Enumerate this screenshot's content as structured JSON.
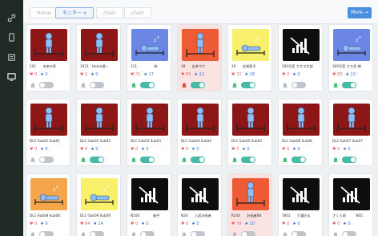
{
  "sidebar": {
    "items": [
      {
        "icon": "link-icon"
      },
      {
        "icon": "phone-icon"
      },
      {
        "icon": "document-icon"
      },
      {
        "icon": "monitor-icon"
      }
    ]
  },
  "topbar": {
    "tabs": [
      {
        "label": "Home",
        "active": false
      },
      {
        "label": "モニター ∨",
        "active": true
      },
      {
        "label": "chart",
        "active": false
      },
      {
        "label": "chart",
        "active": false
      }
    ],
    "more_label": "More →"
  },
  "cards": [
    {
      "label": "101　　未来の家",
      "heart": "0",
      "lung": "0",
      "icon": "person-standing",
      "bg": "#8c1716",
      "fg": "#8fbdf4",
      "toggle": false,
      "alert": false,
      "bell": "gray"
    },
    {
      "label": "1021　Home通ー",
      "heart": "0",
      "lung": "0",
      "icon": "person-standing",
      "bg": "#8c1716",
      "fg": "#8fbdf4",
      "toggle": false,
      "alert": false,
      "bell": "gray"
    },
    {
      "label": "111　　　　　😂",
      "heart": "71",
      "lung": "17",
      "icon": "person-sleeping",
      "bg": "#6c86e6",
      "fg": "#8fbdf4",
      "toggle": true,
      "alert": false,
      "bell": "green"
    },
    {
      "label": "18　　白井タケ",
      "heart": "65",
      "lung": "22",
      "icon": "person-standing",
      "bg": "#ef5b35",
      "fg": "#8fbdf4",
      "toggle": true,
      "alert": true,
      "bell": "red"
    },
    {
      "label": "19　　金城智子",
      "heart": "72",
      "lung": "18",
      "icon": "person-sleeping",
      "bg": "#f8f06a",
      "fg": "#8fbdf4",
      "toggle": true,
      "alert": false,
      "bell": "green"
    },
    {
      "label": "200号室 カオス大部",
      "heart": "0",
      "lung": "0",
      "icon": "no-signal",
      "bg": "#0e0e0e",
      "fg": "#ffffff",
      "toggle": false,
      "alert": false,
      "bell": "gray"
    },
    {
      "label": "300号室 オス武 様",
      "heart": "83",
      "lung": "13",
      "icon": "person-sleeping",
      "bg": "#6c86e6",
      "fg": "#8fbdf4",
      "toggle": true,
      "alert": false,
      "bell": "green"
    },
    {
      "label": "DLC-Sub01 Sub01",
      "heart": "0",
      "lung": "0",
      "icon": "person-standing",
      "bg": "#8c1716",
      "fg": "#8fbdf4",
      "toggle": false,
      "alert": false,
      "bell": "gray"
    },
    {
      "label": "DLC-Sub02 Sub02",
      "heart": "0",
      "lung": "0",
      "icon": "person-standing",
      "bg": "#8c1716",
      "fg": "#8fbdf4",
      "toggle": true,
      "alert": false,
      "bell": "green"
    },
    {
      "label": "DLC-Sub03 Sub03",
      "heart": "0",
      "lung": "0",
      "icon": "person-standing",
      "bg": "#8c1716",
      "fg": "#8fbdf4",
      "toggle": true,
      "alert": false,
      "bell": "green"
    },
    {
      "label": "DLC-Sub04 Sub04",
      "heart": "0",
      "lung": "0",
      "icon": "person-standing",
      "bg": "#8c1716",
      "fg": "#8fbdf4",
      "toggle": true,
      "alert": false,
      "bell": "green"
    },
    {
      "label": "DLC-Sub05 Sub05",
      "heart": "0",
      "lung": "0",
      "icon": "person-standing",
      "bg": "#8c1716",
      "fg": "#8fbdf4",
      "toggle": true,
      "alert": false,
      "bell": "green"
    },
    {
      "label": "DLC-Sub06 Sub06",
      "heart": "0",
      "lung": "0",
      "icon": "person-standing",
      "bg": "#8c1716",
      "fg": "#8fbdf4",
      "toggle": true,
      "alert": false,
      "bell": "green"
    },
    {
      "label": "DLC-Sub07 Sub07",
      "heart": "0",
      "lung": "0",
      "icon": "person-standing",
      "bg": "#8c1716",
      "fg": "#8fbdf4",
      "toggle": true,
      "alert": false,
      "bell": "green"
    },
    {
      "label": "DLC-Sub08 Sub08",
      "heart": "0",
      "lung": "0",
      "icon": "person-sleeping",
      "bg": "#f5a64a",
      "fg": "#8fbdf4",
      "toggle": false,
      "alert": false,
      "bell": "gray"
    },
    {
      "label": "DLC-Sub09 Sub09",
      "heart": "64",
      "lung": "14",
      "icon": "person-sleeping",
      "bg": "#f8f06a",
      "fg": "#8fbdf4",
      "toggle": false,
      "alert": false,
      "bell": "gray"
    },
    {
      "label": "N106　　　　雄子",
      "heart": "0",
      "lung": "0",
      "icon": "no-signal",
      "bg": "#0e0e0e",
      "fg": "#ffffff",
      "toggle": false,
      "alert": false,
      "bell": "gray"
    },
    {
      "label": "N26　　入居計画者",
      "heart": "0",
      "lung": "0",
      "icon": "no-signal",
      "bg": "#0e0e0e",
      "fg": "#ffffff",
      "toggle": false,
      "alert": false,
      "bell": "gray"
    },
    {
      "label": "R244　　計画者N4",
      "heart": "70",
      "lung": "20",
      "icon": "person-standing",
      "bg": "#ef5b35",
      "fg": "#8fbdf4",
      "toggle": false,
      "alert": true,
      "bell": "gray"
    },
    {
      "label": "T801　　介護きま",
      "heart": "0",
      "lung": "0",
      "icon": "no-signal",
      "bg": "#0e0e0e",
      "fg": "#ffffff",
      "toggle": false,
      "alert": false,
      "bell": "gray"
    },
    {
      "label": "さくら邸　　　N05",
      "heart": "0",
      "lung": "0",
      "icon": "no-signal",
      "bg": "#0e0e0e",
      "fg": "#ffffff",
      "toggle": false,
      "alert": false,
      "bell": "gray"
    }
  ]
}
